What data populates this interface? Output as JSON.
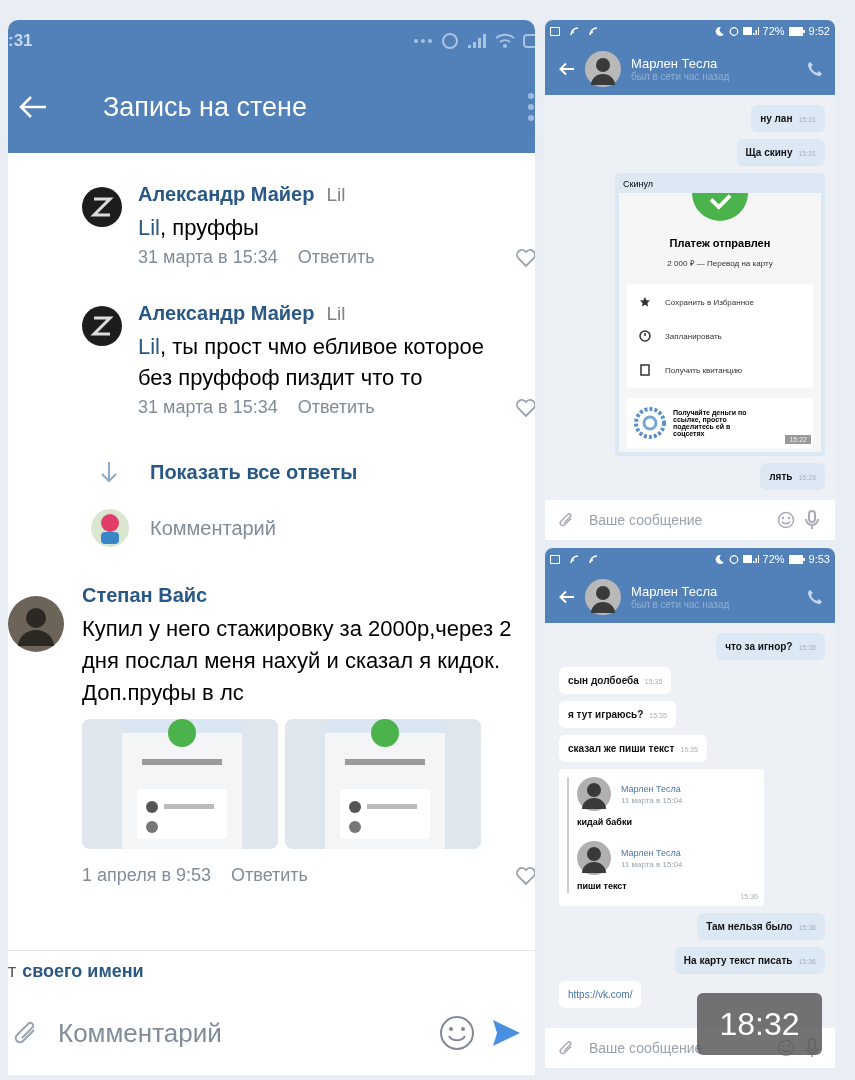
{
  "wall": {
    "status_time": ":31",
    "title": "Запись на стене",
    "replies": [
      {
        "author": "Александр Майер",
        "addressee": "Lil",
        "mention": "Lil",
        "text": ", пруффы",
        "date": "31 марта в 15:34",
        "reply": "Ответить"
      },
      {
        "author": "Александр Майер",
        "addressee": "Lil",
        "mention": "Lil",
        "text": ", ты прост чмо ебливое которое без пруффоф пиздит что то",
        "date": "31 марта в 15:34",
        "reply": "Ответить"
      }
    ],
    "show_all": "Показать все ответы",
    "reply_placeholder": "Комментарий",
    "comment": {
      "author": "Степан Вайс",
      "paragraphs": [
        "Купил у него стажировку за 2000р,через 2 дня послал меня нахуй и сказал я кидок.",
        "Доп.пруфы в лс"
      ],
      "attachments": [
        {
          "kind": "picture"
        },
        {
          "kind": "picture"
        }
      ],
      "date": "1 апреля в 9:53",
      "reply": "Ответить"
    },
    "identity_prefix": "т",
    "identity_link": "своего имени",
    "input_placeholder": "Комментарий"
  },
  "chats": [
    {
      "battery": "72%",
      "time": "9:52",
      "contact": "Марлен Тесла",
      "presence": "был в сети час назад",
      "placeholder": "Ваше сообщение",
      "messages": [
        {
          "kind": "out",
          "text": "ну лан",
          "time": "15:21"
        },
        {
          "kind": "out",
          "text": "Ща скину",
          "time": "15:21"
        },
        {
          "kind": "card",
          "header": "Скинул",
          "title": "Платеж отправлен",
          "subtitle": "2 000 ₽ — Перевод на карту",
          "actions": [
            "Сохранить в Избранное",
            "Запланировать",
            "Получить квитанцию"
          ],
          "promo": "Получайте деньги по ссылке, просто поделитесь ей в соцсетях",
          "time": "15:22"
        },
        {
          "kind": "out",
          "text": "лять",
          "time": "15:23"
        }
      ]
    },
    {
      "battery": "72%",
      "time": "9:53",
      "contact": "Марлен Тесла",
      "presence": "был в сети час назад",
      "placeholder": "Ваше сообщение",
      "messages": [
        {
          "kind": "out",
          "text": "что за игнор?",
          "time": "15:35"
        },
        {
          "kind": "in",
          "text": "сын долбоеба",
          "time": "15:35"
        },
        {
          "kind": "in",
          "text": "я тут играюсь?",
          "time": "15:35"
        },
        {
          "kind": "in",
          "text": "сказал же пиши текст",
          "time": "15:35"
        },
        {
          "kind": "forward",
          "items": [
            {
              "name": "Марлен Тесла",
              "date": "11 марта в 15:04",
              "text": "кидай бабки"
            },
            {
              "name": "Марлен Тесла",
              "date": "11 марта в 15:04",
              "text": "пиши текст"
            }
          ],
          "time": "15:36"
        },
        {
          "kind": "out",
          "text": "Там нельзя было",
          "time": "15:36"
        },
        {
          "kind": "out",
          "text": "На карту текст писать",
          "time": "15:36"
        },
        {
          "kind": "link",
          "text": "https://vk.com/"
        }
      ]
    }
  ],
  "overlay_time": "18:32"
}
